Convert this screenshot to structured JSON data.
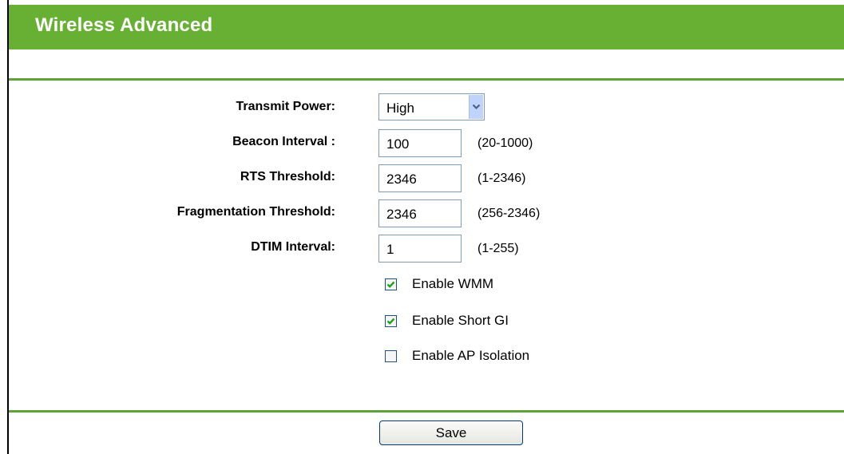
{
  "header": {
    "title": "Wireless Advanced",
    "color": "#68b033"
  },
  "form": {
    "transmit_power": {
      "label": "Transmit Power:",
      "value": "High"
    },
    "beacon_interval": {
      "label": "Beacon Interval :",
      "value": "100",
      "range": "(20-1000)"
    },
    "rts_threshold": {
      "label": "RTS Threshold:",
      "value": "2346",
      "range": "(1-2346)"
    },
    "fragmentation_threshold": {
      "label": "Fragmentation Threshold:",
      "value": "2346",
      "range": "(256-2346)"
    },
    "dtim_interval": {
      "label": "DTIM Interval:",
      "value": "1",
      "range": "(1-255)"
    },
    "enable_wmm": {
      "label": "Enable WMM",
      "checked": true
    },
    "enable_short_gi": {
      "label": "Enable Short GI",
      "checked": true
    },
    "enable_ap_isolation": {
      "label": "Enable AP Isolation",
      "checked": false
    }
  },
  "actions": {
    "save_label": "Save"
  }
}
